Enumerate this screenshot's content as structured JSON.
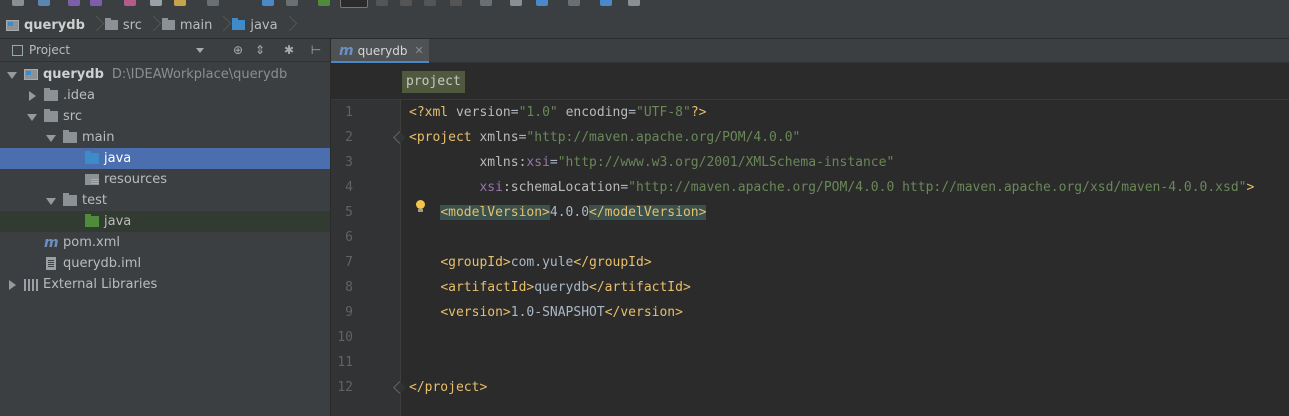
{
  "breadcrumb": {
    "items": [
      {
        "label": "querydb",
        "icon": "module-icon"
      },
      {
        "label": "src",
        "icon": "folder-icon"
      },
      {
        "label": "main",
        "icon": "folder-icon"
      },
      {
        "label": "java",
        "icon": "source-folder-icon"
      }
    ]
  },
  "project_panel": {
    "view_label": "Project",
    "tree": [
      {
        "label": "querydb",
        "detail": "D:\\IDEAWorkplace\\querydb",
        "icon": "module-icon",
        "expanded": true
      },
      {
        "label": ".idea",
        "icon": "folder-icon",
        "expanded": false
      },
      {
        "label": "src",
        "icon": "folder-icon",
        "expanded": true
      },
      {
        "label": "main",
        "icon": "folder-icon",
        "expanded": true
      },
      {
        "label": "java",
        "icon": "source-folder-icon",
        "selected": true
      },
      {
        "label": "resources",
        "icon": "resources-folder-icon"
      },
      {
        "label": "test",
        "icon": "folder-icon",
        "expanded": true
      },
      {
        "label": "java",
        "icon": "test-folder-icon"
      },
      {
        "label": "pom.xml",
        "icon": "maven-icon"
      },
      {
        "label": "querydb.iml",
        "icon": "iml-file-icon"
      },
      {
        "label": "External Libraries",
        "icon": "libraries-icon",
        "expanded": false
      }
    ]
  },
  "editor": {
    "tab_label": "querydb",
    "xml_breadcrumb": "project",
    "line_numbers": [
      "1",
      "2",
      "3",
      "4",
      "5",
      "6",
      "7",
      "8",
      "9",
      "10",
      "11",
      "12"
    ],
    "lines": {
      "l1_decl_open": "<?xml ",
      "l1_attr1": "version",
      "l1_val1": "\"1.0\"",
      "l1_attr2": "encoding",
      "l1_val2": "\"UTF-8\"",
      "l1_decl_close": "?>",
      "l2_open": "<project ",
      "l2_attr": "xmlns",
      "l2_val": "\"http://maven.apache.org/POM/4.0.0\"",
      "l3_attr_a": "xmlns",
      "l3_ns": "xsi",
      "l3_val": "\"http://www.w3.org/2001/XMLSchema-instance\"",
      "l4_ns": "xsi",
      "l4_attr": "schemaLocation",
      "l4_val": "\"http://maven.apache.org/POM/4.0.0 http://maven.apache.org/xsd/maven-4.0.0.xsd\"",
      "l4_close": ">",
      "l5_open": "<modelVersion>",
      "l5_text": "4.0.0",
      "l5_close": "</modelVersion>",
      "l7_open": "<groupId>",
      "l7_text": "com.yule",
      "l7_close": "</groupId>",
      "l8_open": "<artifactId>",
      "l8_text": "querydb",
      "l8_close": "</artifactId>",
      "l9_open": "<version>",
      "l9_text": "1.0-SNAPSHOT",
      "l9_close": "</version>",
      "l12_close": "</project>"
    }
  },
  "colors": {
    "selection": "#4b6eaf",
    "tag": "#e8bf6a",
    "string": "#6a8759",
    "namespace": "#9876aa"
  }
}
